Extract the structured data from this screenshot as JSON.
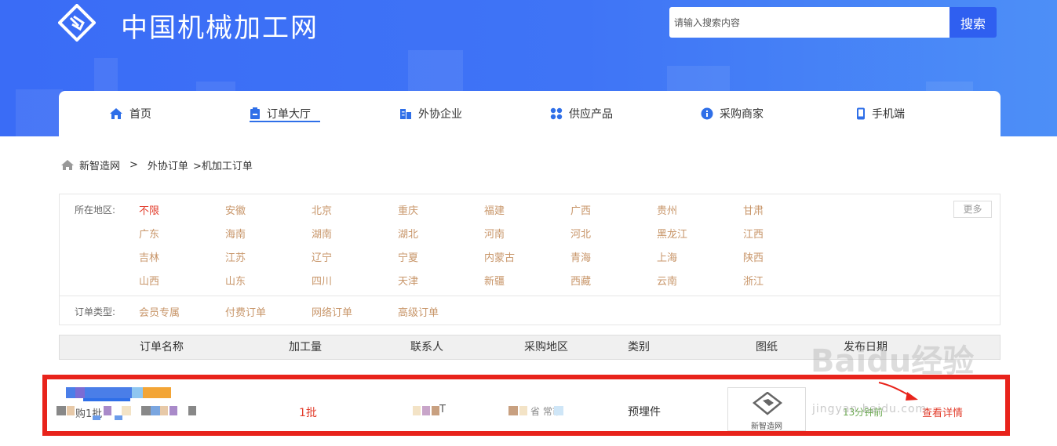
{
  "header": {
    "site_title": "中国机械加工网",
    "search_placeholder": "请输入搜索内容",
    "search_button": "搜索"
  },
  "nav": [
    {
      "label": "首页",
      "icon": "home-icon"
    },
    {
      "label": "订单大厅",
      "icon": "clipboard-icon",
      "active": true
    },
    {
      "label": "外协企业",
      "icon": "building-icon"
    },
    {
      "label": "供应产品",
      "icon": "grid-icon"
    },
    {
      "label": "采购商家",
      "icon": "info-icon"
    },
    {
      "label": "手机端",
      "icon": "mobile-icon"
    }
  ],
  "breadcrumb": {
    "home": "新智造网",
    "sep": ">",
    "level1": "外协订单",
    "level2": ">机加工订单"
  },
  "filters": {
    "region_label": "所在地区:",
    "regions": [
      [
        "不限",
        "安徽",
        "北京",
        "重庆",
        "福建",
        "广西",
        "贵州",
        "甘肃"
      ],
      [
        "广东",
        "海南",
        "湖南",
        "湖北",
        "河南",
        "河北",
        "黑龙江",
        "江西"
      ],
      [
        "吉林",
        "江苏",
        "辽宁",
        "宁夏",
        "内蒙古",
        "青海",
        "上海",
        "陕西"
      ],
      [
        "山西",
        "山东",
        "四川",
        "天津",
        "新疆",
        "西藏",
        "云南",
        "浙江"
      ]
    ],
    "more": "更多",
    "type_label": "订单类型:",
    "types": [
      "会员专属",
      "付费订单",
      "网络订单",
      "高级订单"
    ]
  },
  "table": {
    "headers": [
      "订单名称",
      "加工量",
      "联系人",
      "采购地区",
      "类别",
      "图纸",
      "发布日期"
    ],
    "row": {
      "name_visible": "购1批",
      "quantity": "1批",
      "contact_visible": "T",
      "region_visible": "省 常市",
      "category": "预埋件",
      "thumb_label": "新智造网",
      "published": "13分钟前",
      "action": "查看详情"
    }
  },
  "watermark": {
    "brand": "Baidu经验",
    "url": "jingyan.baidu.com"
  },
  "colors": {
    "brand_blue": "#3a6cf6",
    "region_link": "#c8966a",
    "active_red": "#e23c2b",
    "highlight_frame": "#e8231b",
    "time_green": "#6aa84f"
  }
}
